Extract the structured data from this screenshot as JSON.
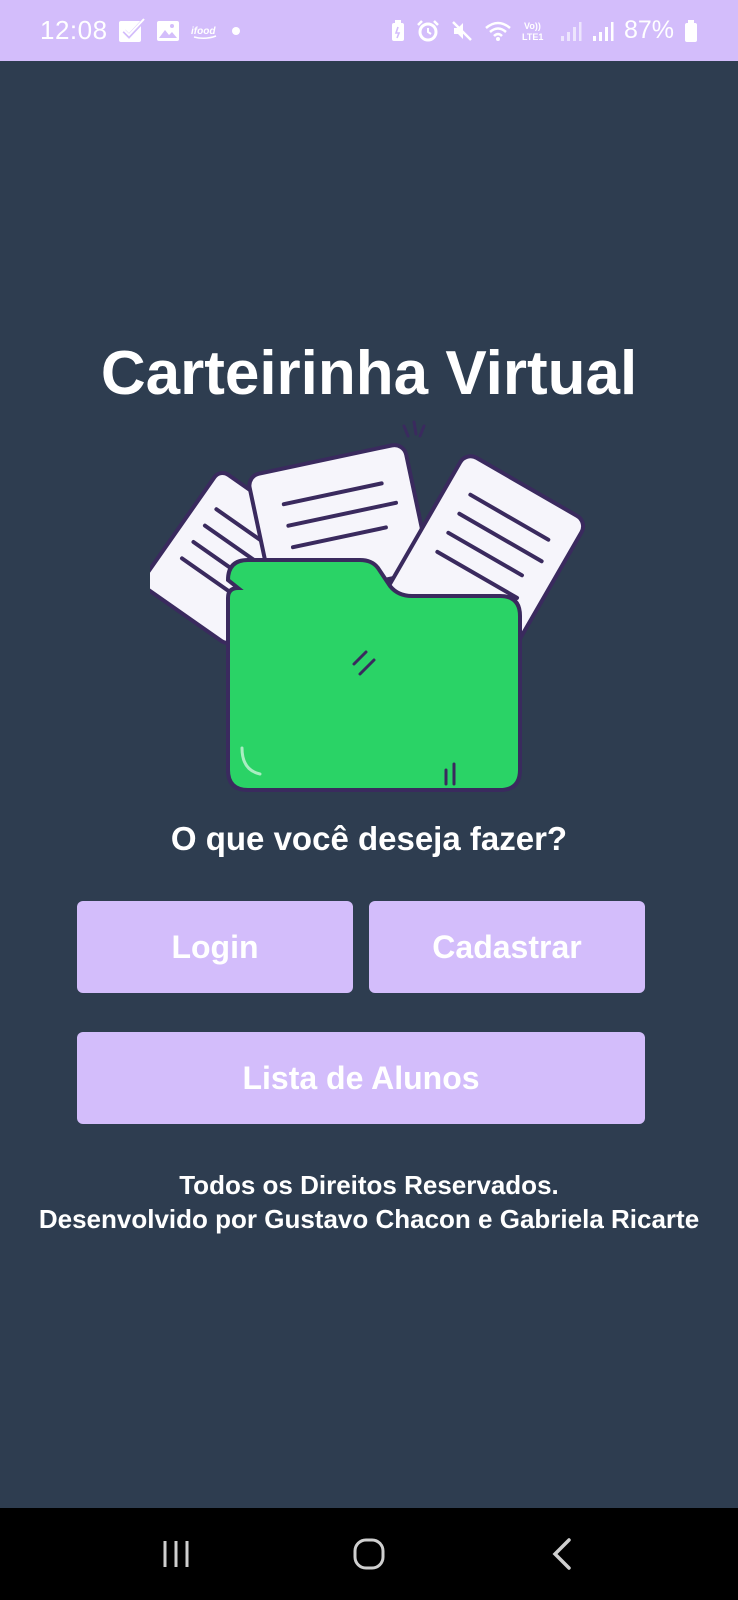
{
  "status_bar": {
    "time": "12:08",
    "battery": "87%",
    "left_icons": [
      "check-app-icon",
      "gallery-icon",
      "ifood-icon",
      "dot-icon"
    ],
    "right_icons": [
      "battery-saver-icon",
      "alarm-icon",
      "mute-icon",
      "wifi-icon",
      "volte-icon",
      "signal-icon",
      "signal-icon-2",
      "battery-icon"
    ],
    "volte_label": "Vo)) LTE1",
    "ifood_label": "ifood"
  },
  "app": {
    "title": "Carteirinha Virtual",
    "question": "O que você deseja fazer?"
  },
  "buttons": {
    "login": "Login",
    "register": "Cadastrar",
    "student_list": "Lista de Alunos"
  },
  "footer": {
    "line1": "Todos os Direitos Reservados.",
    "line2": "Desenvolvido por Gustavo Chacon e Gabriela Ricarte"
  },
  "nav_bar": {
    "icons": [
      "recent-apps-icon",
      "home-icon",
      "back-icon"
    ]
  },
  "colors": {
    "background": "#2e3d50",
    "accent": "#d3bdfb",
    "folder": "#2ad366",
    "outline": "#3a2a5e"
  }
}
